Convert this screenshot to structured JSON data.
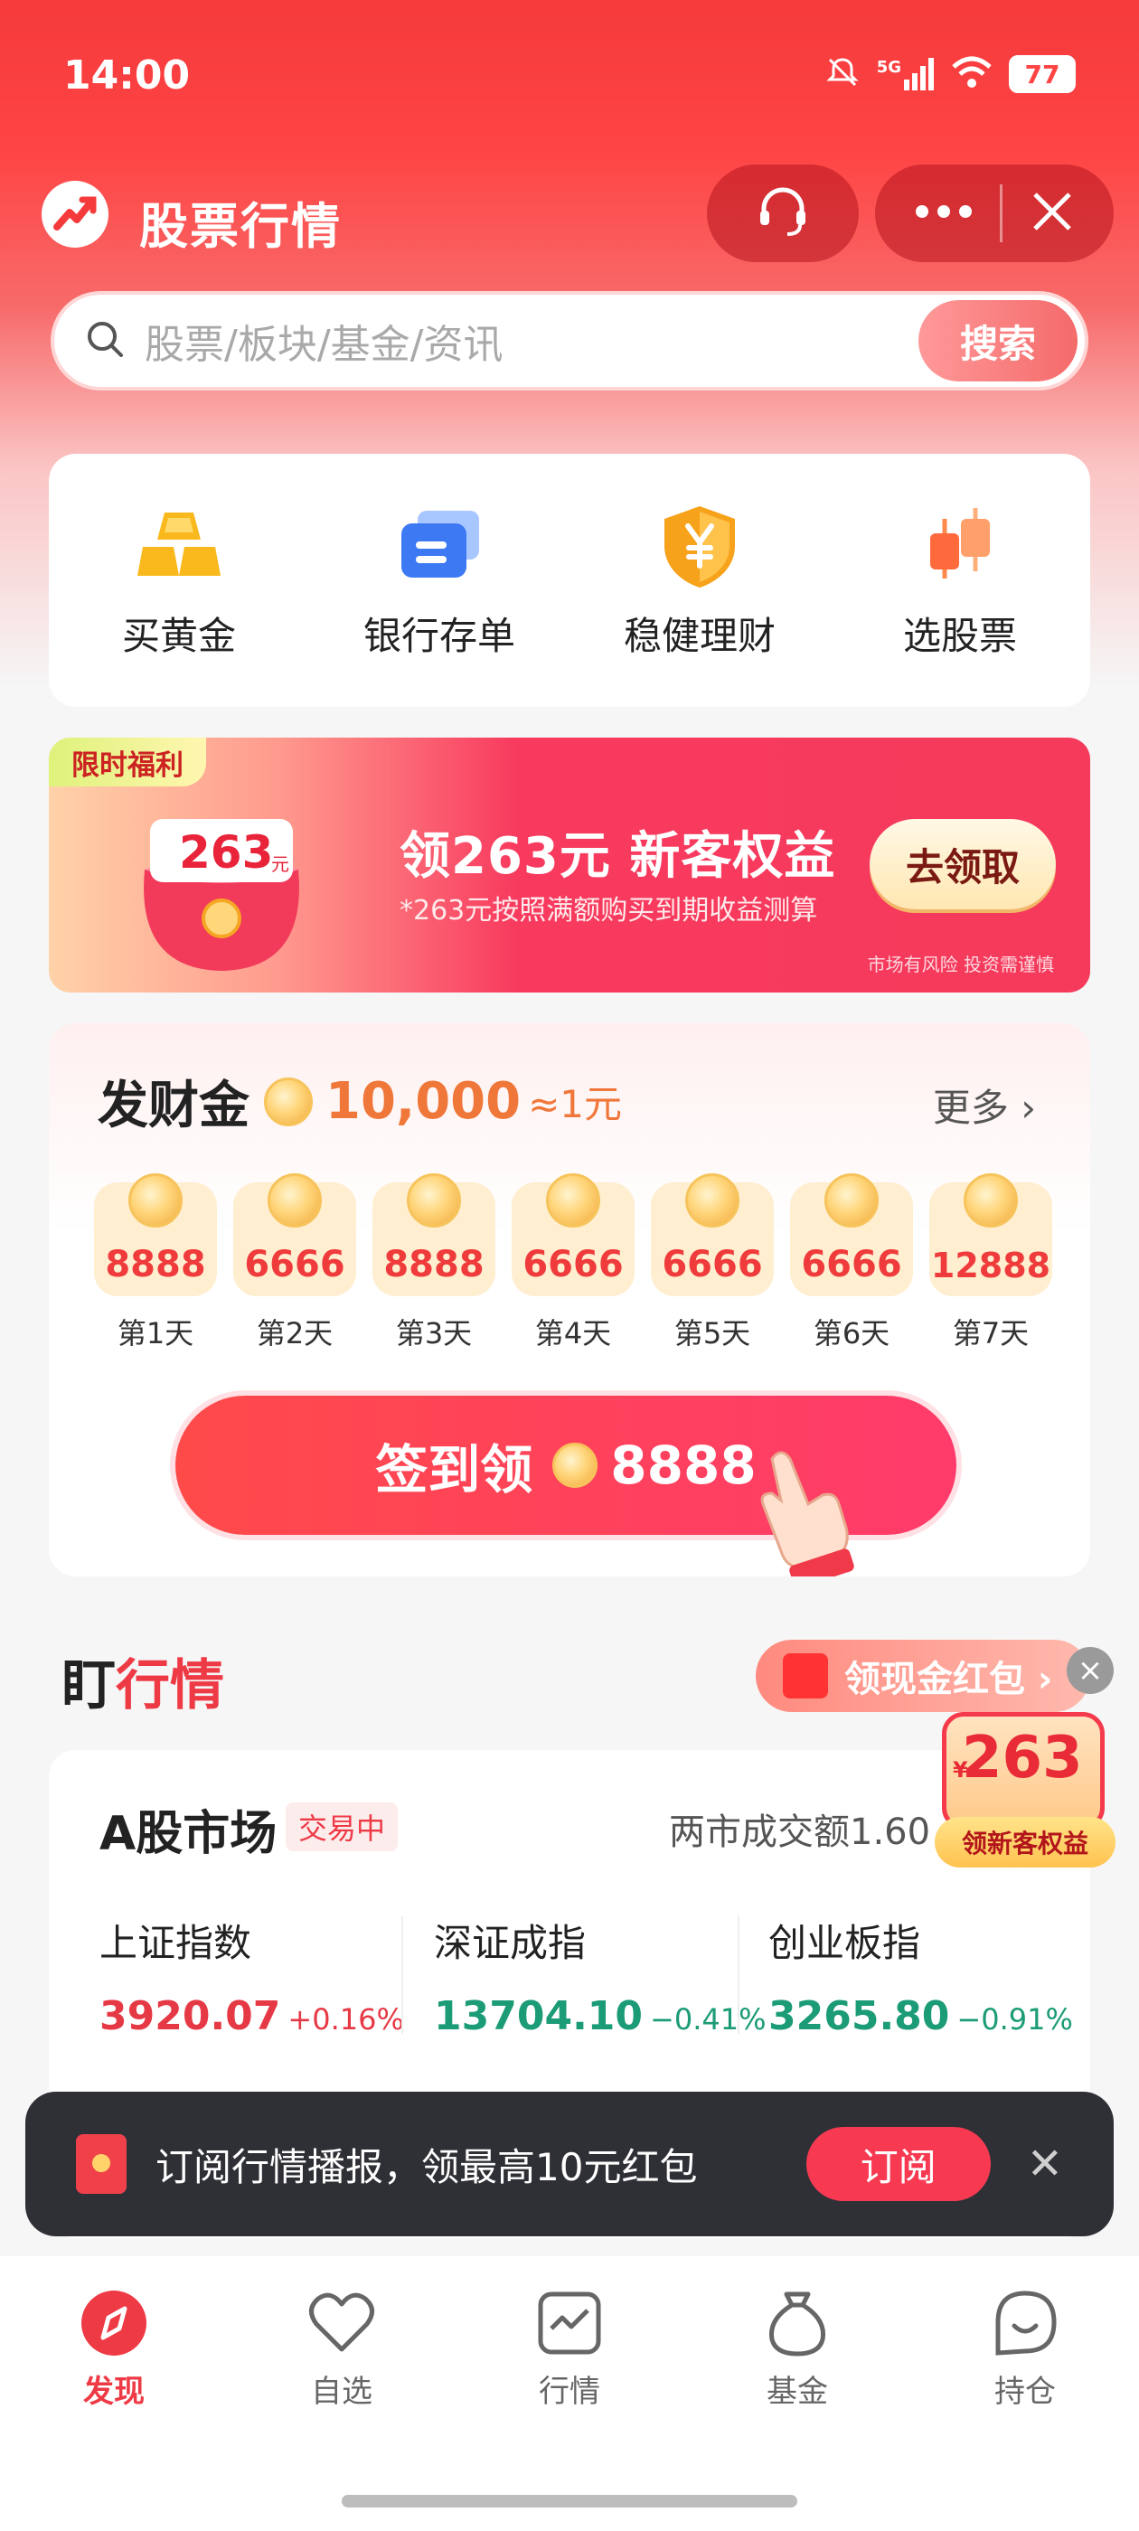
{
  "status_bar": {
    "time": "14:00",
    "network": "5G",
    "battery": "77"
  },
  "header": {
    "title": "股票行情"
  },
  "search": {
    "placeholder": "股票/板块/基金/资讯",
    "button": "搜索"
  },
  "quick_menu": [
    {
      "label": "买黄金",
      "icon": "gold-bars-icon"
    },
    {
      "label": "银行存单",
      "icon": "bank-card-icon"
    },
    {
      "label": "稳健理财",
      "icon": "yuan-shield-icon"
    },
    {
      "label": "选股票",
      "icon": "candlestick-icon"
    }
  ],
  "banner": {
    "tag": "限时福利",
    "bag_value": "263",
    "bag_unit": "元",
    "title": "领263元 新客权益",
    "subtitle": "*263元按照满额购买到期收益测算",
    "button": "去领取",
    "risk": "市场有风险 投资需谨慎"
  },
  "checkin": {
    "title": "发财金",
    "amount": "10,000",
    "rate": "≈1元",
    "more": "更多 ›",
    "days": [
      {
        "value": "8888",
        "label": "第1天"
      },
      {
        "value": "6666",
        "label": "第2天"
      },
      {
        "value": "8888",
        "label": "第3天"
      },
      {
        "value": "6666",
        "label": "第4天"
      },
      {
        "value": "6666",
        "label": "第5天"
      },
      {
        "value": "6666",
        "label": "第6天"
      },
      {
        "value": "12888",
        "label": "第7天"
      }
    ],
    "button_prefix": "签到领",
    "button_amount": "8888"
  },
  "market_section": {
    "title_prefix": "盯",
    "title_highlight": "行情",
    "redpack": "领现金红包 ›",
    "close": "×"
  },
  "market": {
    "title": "A股市场",
    "status": "交易中",
    "volume": "两市成交额1.60",
    "indices": [
      {
        "name": "上证指数",
        "value": "3920.07",
        "change": "+0.16%",
        "direction": "up"
      },
      {
        "name": "深证成指",
        "value": "13704.10",
        "change": "−0.41%",
        "direction": "down"
      },
      {
        "name": "创业板指",
        "value": "3265.80",
        "change": "−0.91%",
        "direction": "down"
      }
    ]
  },
  "float_promo": {
    "yen": "¥",
    "value": "263",
    "button": "领新客权益"
  },
  "toast": {
    "text": "订阅行情播报，领最高10元红包",
    "button": "订阅",
    "close": "✕"
  },
  "bottom_nav": [
    {
      "label": "发现",
      "active": true
    },
    {
      "label": "自选",
      "active": false
    },
    {
      "label": "行情",
      "active": false
    },
    {
      "label": "基金",
      "active": false
    },
    {
      "label": "持仓",
      "active": false
    }
  ],
  "colors": {
    "brand_red": "#f53a3c",
    "up": "#e63946",
    "down": "#1b9b76",
    "coin": "#ffd57a"
  }
}
